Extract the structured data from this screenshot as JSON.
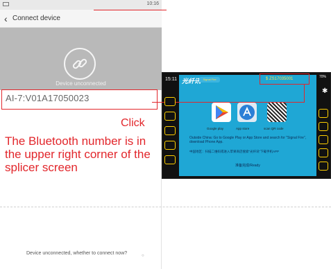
{
  "phone": {
    "status_time": "10:16",
    "title": "Connect device",
    "unconnected_label": "Device unconnected",
    "device_id": "AI-7:V01A17050023",
    "device_sub": "",
    "click": "Click",
    "note": "The Bluetooth number is in the upper right corner of the splicer screen",
    "bottom_message": "Device unconnected, whether to connect now?"
  },
  "splicer": {
    "time": "15:11",
    "logo": "光纤讯",
    "subtitle": "Signal Fire",
    "bt_number": "$ ZS17035001",
    "battery_text": "70%",
    "apps": [
      {
        "label": "Google play"
      },
      {
        "label": "App store"
      },
      {
        "label": "scan QR code"
      }
    ],
    "outside_text": "Outside China: Go to Google Play or App Store and search for \"Signal Fire\", download Phone App.",
    "china_text": "中国地区：扫描二维码或进入苹果商店搜索“光纤讯”下载手机APP",
    "ready": "准备完成/Ready"
  }
}
